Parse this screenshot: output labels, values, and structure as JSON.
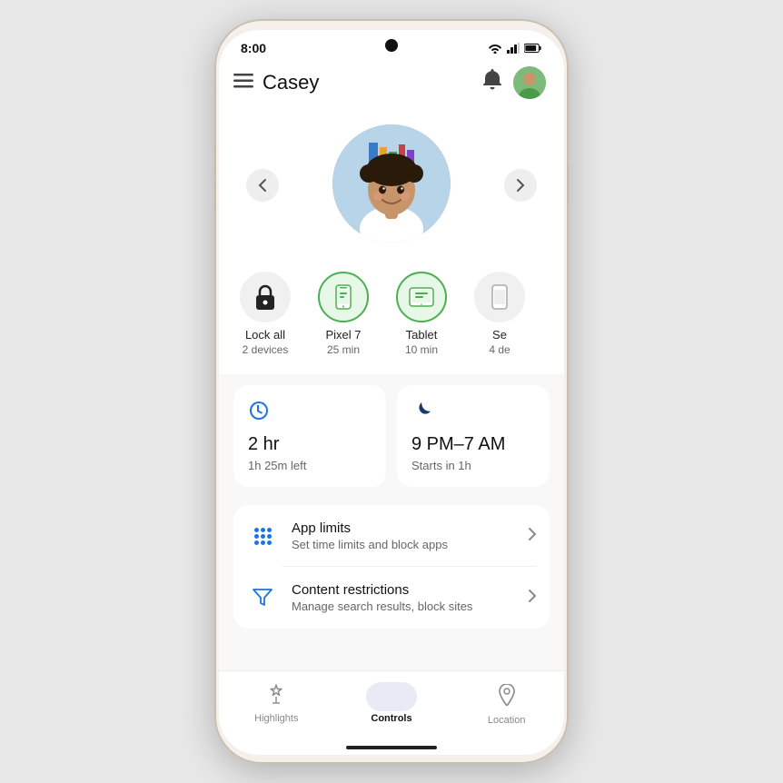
{
  "phone": {
    "status_bar": {
      "time": "8:00",
      "wifi_icon": "wifi",
      "signal_icon": "signal",
      "battery_icon": "battery"
    },
    "header": {
      "menu_icon": "☰",
      "title": "Casey",
      "bell_icon": "🔔",
      "avatar_text": "👩"
    },
    "profile": {
      "left_arrow": "‹",
      "right_arrow": "›"
    },
    "devices": [
      {
        "id": "lock-all",
        "icon": "🔒",
        "icon_type": "lock",
        "label": "Lock all",
        "sub": "2 devices"
      },
      {
        "id": "pixel7",
        "icon": "📱",
        "icon_type": "green",
        "label": "Pixel 7",
        "sub": "25 min"
      },
      {
        "id": "tablet",
        "icon": "📱",
        "icon_type": "green",
        "label": "Tablet",
        "sub": "10 min"
      },
      {
        "id": "se",
        "icon": "📱",
        "icon_type": "gray",
        "label": "Se",
        "sub": "4 de"
      }
    ],
    "time_cards": [
      {
        "id": "screen-time",
        "icon": "🕐",
        "icon_color": "blue",
        "main": "2 hr",
        "sub": "1h 25m left"
      },
      {
        "id": "bedtime",
        "icon": "🌙",
        "icon_color": "dark-blue",
        "main": "9 PM–7 AM",
        "sub": "Starts in 1h"
      }
    ],
    "menu_items": [
      {
        "id": "app-limits",
        "icon": "dots-grid",
        "title": "App limits",
        "subtitle": "Set time limits and block apps",
        "chevron": "›"
      },
      {
        "id": "content-restrictions",
        "icon": "funnel",
        "title": "Content restrictions",
        "subtitle": "Manage search results, block sites",
        "chevron": "›"
      }
    ],
    "bottom_nav": [
      {
        "id": "highlights",
        "icon": "✦",
        "label": "Highlights",
        "active": false
      },
      {
        "id": "controls",
        "icon": "⊞",
        "label": "Controls",
        "active": true
      },
      {
        "id": "location",
        "icon": "📍",
        "label": "Location",
        "active": false
      }
    ]
  }
}
